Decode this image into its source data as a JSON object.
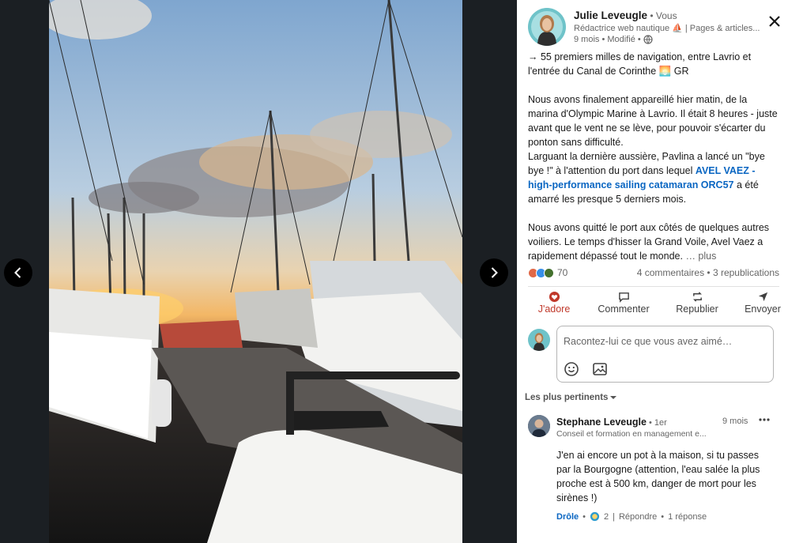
{
  "viewer": {
    "prev_icon": "chevron-left-icon",
    "next_icon": "chevron-right-icon"
  },
  "author": {
    "name": "Julie Leveugle",
    "degree": " • Vous",
    "tagline": "Rédactrice web nautique ⛵ | Pages & articles...",
    "meta": "9 mois • Modifié •",
    "visibility_icon": "globe-icon"
  },
  "post": {
    "p1": "→ 55 premiers milles de navigation, entre Lavrio et l'entrée du Canal de Corinthe 🌅 GR",
    "p2": "Nous avons finalement appareillé hier matin, de la marina d'Olympic Marine à Lavrio. Il était 8 heures - juste avant que le vent ne se lève, pour pouvoir s'écarter du ponton sans difficulté.\nLarguant la dernière aussière, Pavlina a lancé un \"bye bye !\" à l'attention du port dans lequel",
    "link": "AVEL VAEZ - high-performance sailing catamaran ORC57",
    "p2_end": " a été amarré les presque 5 derniers mois.",
    "p3": "Nous avons quitté le port aux côtés de quelques autres voiliers. Le temps d'hisser la Grand Voile, Avel Vaez a rapidement dépassé tout le monde.",
    "more": "… plus"
  },
  "social": {
    "reaction_count": "70",
    "counts": "4 commentaires • 3 republications"
  },
  "actions": {
    "love": "J'adore",
    "comment": "Commenter",
    "repost": "Republier",
    "send": "Envoyer"
  },
  "comment_box": {
    "placeholder": "Racontez-lui ce que vous avez aimé…"
  },
  "sort_label": "Les plus pertinents",
  "comment": {
    "name": "Stephane Leveugle",
    "degree": " • 1er",
    "tagline": "Conseil et formation en management e...",
    "time": "9 mois",
    "body": "J'en ai encore un pot à la maison, si tu passes par la Bourgogne (attention, l'eau salée la plus proche est à 500 km, danger de mort pour les sirènes !)",
    "like_label": "Drôle",
    "like_count": "2",
    "reply_label": "Répondre",
    "replies": "1 réponse"
  },
  "colors": {
    "accent": "#0a66c2",
    "love": "#c0392b",
    "viewer_bg": "#1b1f23"
  }
}
